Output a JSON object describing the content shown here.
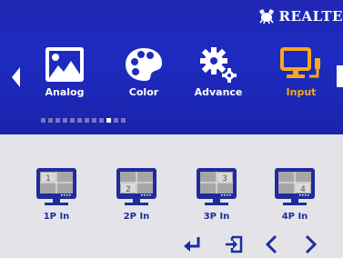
{
  "brand": {
    "text": "REALTE",
    "logo_icon": "realtek-crab-icon"
  },
  "nav": {
    "left_icon": "triangle-left-icon",
    "right_icon": "cut-off-icon"
  },
  "main_menu": [
    {
      "label": "Analog",
      "icon": "analog-picture-icon",
      "active": false
    },
    {
      "label": "Color",
      "icon": "color-palette-icon",
      "active": false
    },
    {
      "label": "Advance",
      "icon": "gear-icon",
      "active": false
    },
    {
      "label": "Input",
      "icon": "input-monitor-icon",
      "active": true
    }
  ],
  "page_indicator": {
    "total": 12,
    "current_index": 9
  },
  "submenu": [
    {
      "label": "1P In",
      "icon": "quad-monitor-icon",
      "highlight_number": "1"
    },
    {
      "label": "2P In",
      "icon": "quad-monitor-icon",
      "highlight_number": "2"
    },
    {
      "label": "3P In",
      "icon": "quad-monitor-icon",
      "highlight_number": "3"
    },
    {
      "label": "4P In",
      "icon": "quad-monitor-icon",
      "highlight_number": "4"
    }
  ],
  "controls": [
    {
      "icon": "enter-icon"
    },
    {
      "icon": "exit-icon"
    },
    {
      "icon": "chevron-left-icon"
    },
    {
      "icon": "chevron-right-icon"
    }
  ],
  "colors": {
    "osd_blue": "#1d2bc0",
    "label_white": "#ffffff",
    "active_orange": "#f7a81d",
    "sub_bg": "#e4e4e8",
    "sub_icon_blue": "#1e2c9e"
  }
}
